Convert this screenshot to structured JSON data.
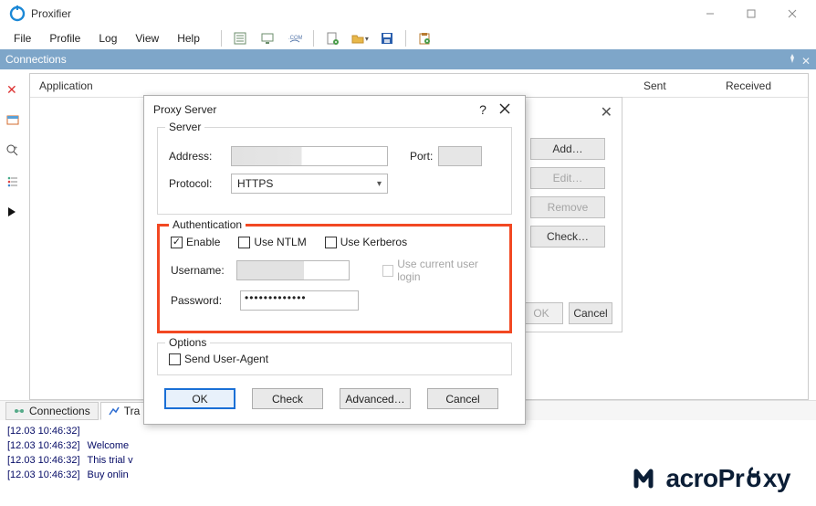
{
  "window": {
    "title": "Proxifier"
  },
  "menu": {
    "file": "File",
    "profile": "Profile",
    "log": "Log",
    "view": "View",
    "help": "Help"
  },
  "connectionsBar": {
    "title": "Connections"
  },
  "columns": {
    "application": "Application",
    "sent": "Sent",
    "received": "Received"
  },
  "bgPanel": {
    "add": "Add…",
    "edit": "Edit…",
    "remove": "Remove",
    "check": "Check…",
    "ok": "OK",
    "cancel": "Cancel"
  },
  "dialog": {
    "title": "Proxy Server",
    "server": {
      "legend": "Server",
      "address_label": "Address:",
      "port_label": "Port:",
      "protocol_label": "Protocol:",
      "protocol_value": "HTTPS"
    },
    "auth": {
      "legend": "Authentication",
      "enable": "Enable",
      "use_ntlm": "Use NTLM",
      "use_kerberos": "Use Kerberos",
      "username_label": "Username:",
      "password_label": "Password:",
      "password_mask": "•••••••••••••",
      "current_user": "Use current user login"
    },
    "options": {
      "legend": "Options",
      "send_ua": "Send User-Agent"
    },
    "buttons": {
      "ok": "OK",
      "check": "Check",
      "advanced": "Advanced…",
      "cancel": "Cancel"
    }
  },
  "tabs": {
    "connections": "Connections",
    "traffic": "Tra"
  },
  "log": {
    "ts": "[12.03 10:46:32]",
    "l1": "Welcome",
    "l2": "This trial v",
    "l3": "Buy onlin"
  },
  "logo": {
    "text": "MacroProxy"
  }
}
